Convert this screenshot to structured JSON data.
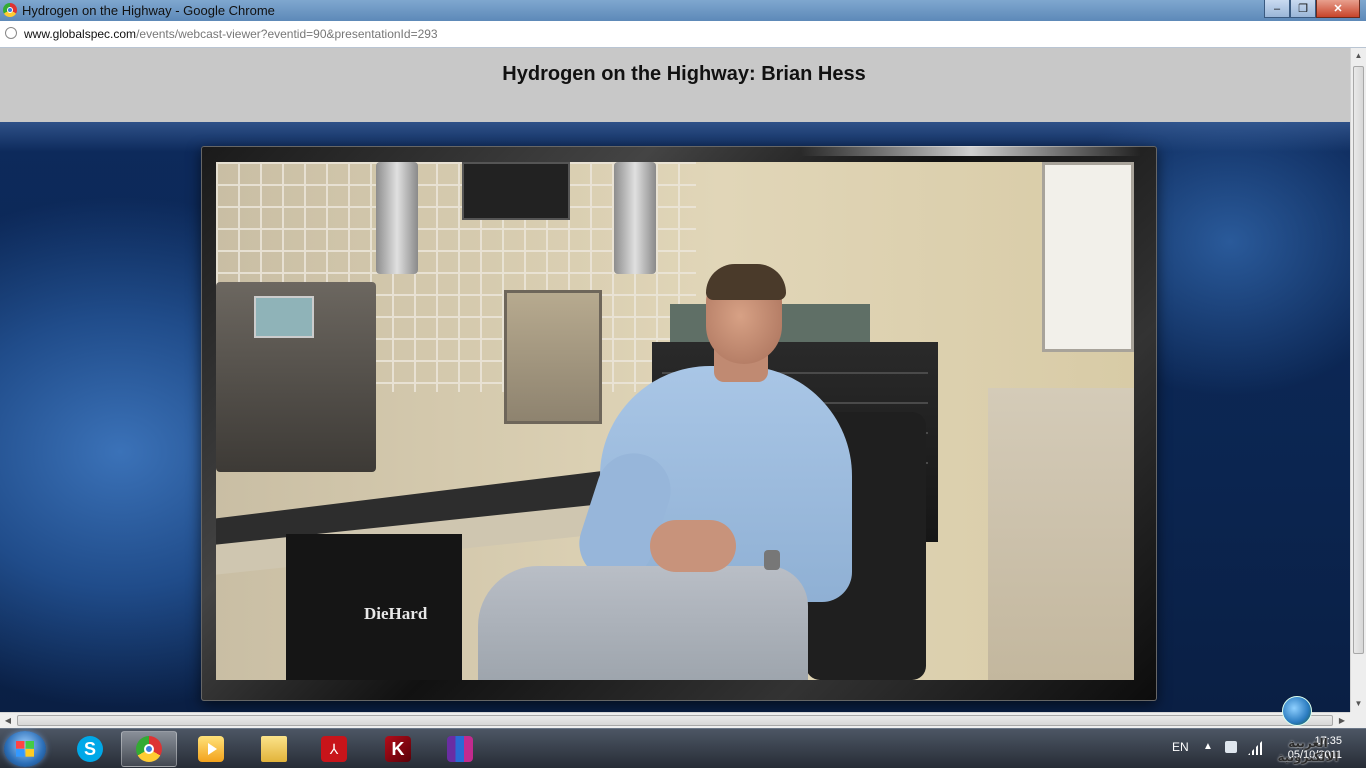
{
  "window": {
    "title": "Hydrogen on the Highway - Google Chrome",
    "controls": {
      "minimize": "–",
      "maximize": "❐",
      "close": "✕"
    }
  },
  "address_bar": {
    "host": "www.globalspec.com",
    "path": "/events/webcast-viewer?eventid=90&presentationId=293"
  },
  "page": {
    "heading": "Hydrogen on the Highway: Brian Hess",
    "video": {
      "charger_label": "DieHard"
    }
  },
  "scrollbars": {
    "up": "▲",
    "down": "▼",
    "left": "◀",
    "right": "▶"
  },
  "taskbar": {
    "pinned": [
      {
        "name": "skype",
        "icon": "skype-icon",
        "glyph": "S"
      },
      {
        "name": "chrome",
        "icon": "chrome-icon",
        "active": true
      },
      {
        "name": "media-player",
        "icon": "media-player-icon"
      },
      {
        "name": "explorer",
        "icon": "folder-icon"
      },
      {
        "name": "adobe-reader",
        "icon": "pdf-icon",
        "glyph": "⅄"
      },
      {
        "name": "kaspersky",
        "icon": "kaspersky-icon",
        "glyph": "K"
      },
      {
        "name": "winrar",
        "icon": "winrar-icon"
      }
    ],
    "tray": {
      "language": "EN",
      "show_hidden": "▲",
      "time": "17:35",
      "date": "05/10/2011"
    }
  },
  "watermark": {
    "text": "الغربية الالكترونية"
  }
}
